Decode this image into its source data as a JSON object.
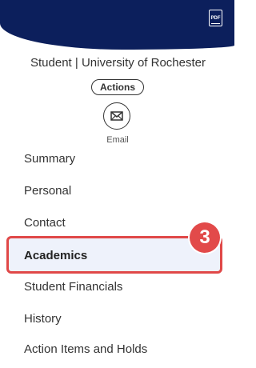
{
  "header": {
    "pdf_label": "PDF",
    "color": "#0c1f5c"
  },
  "profile": {
    "title": "Student | University of Rochester",
    "actions_label": "Actions",
    "email_label": "Email"
  },
  "nav": {
    "items": [
      {
        "label": "Summary"
      },
      {
        "label": "Personal"
      },
      {
        "label": "Contact"
      },
      {
        "label": "Academics",
        "active": true
      },
      {
        "label": "Student Financials"
      },
      {
        "label": "History"
      },
      {
        "label": "Action Items and Holds"
      }
    ]
  },
  "annotation": {
    "step_number": "3",
    "highlight_color": "#e04848"
  }
}
